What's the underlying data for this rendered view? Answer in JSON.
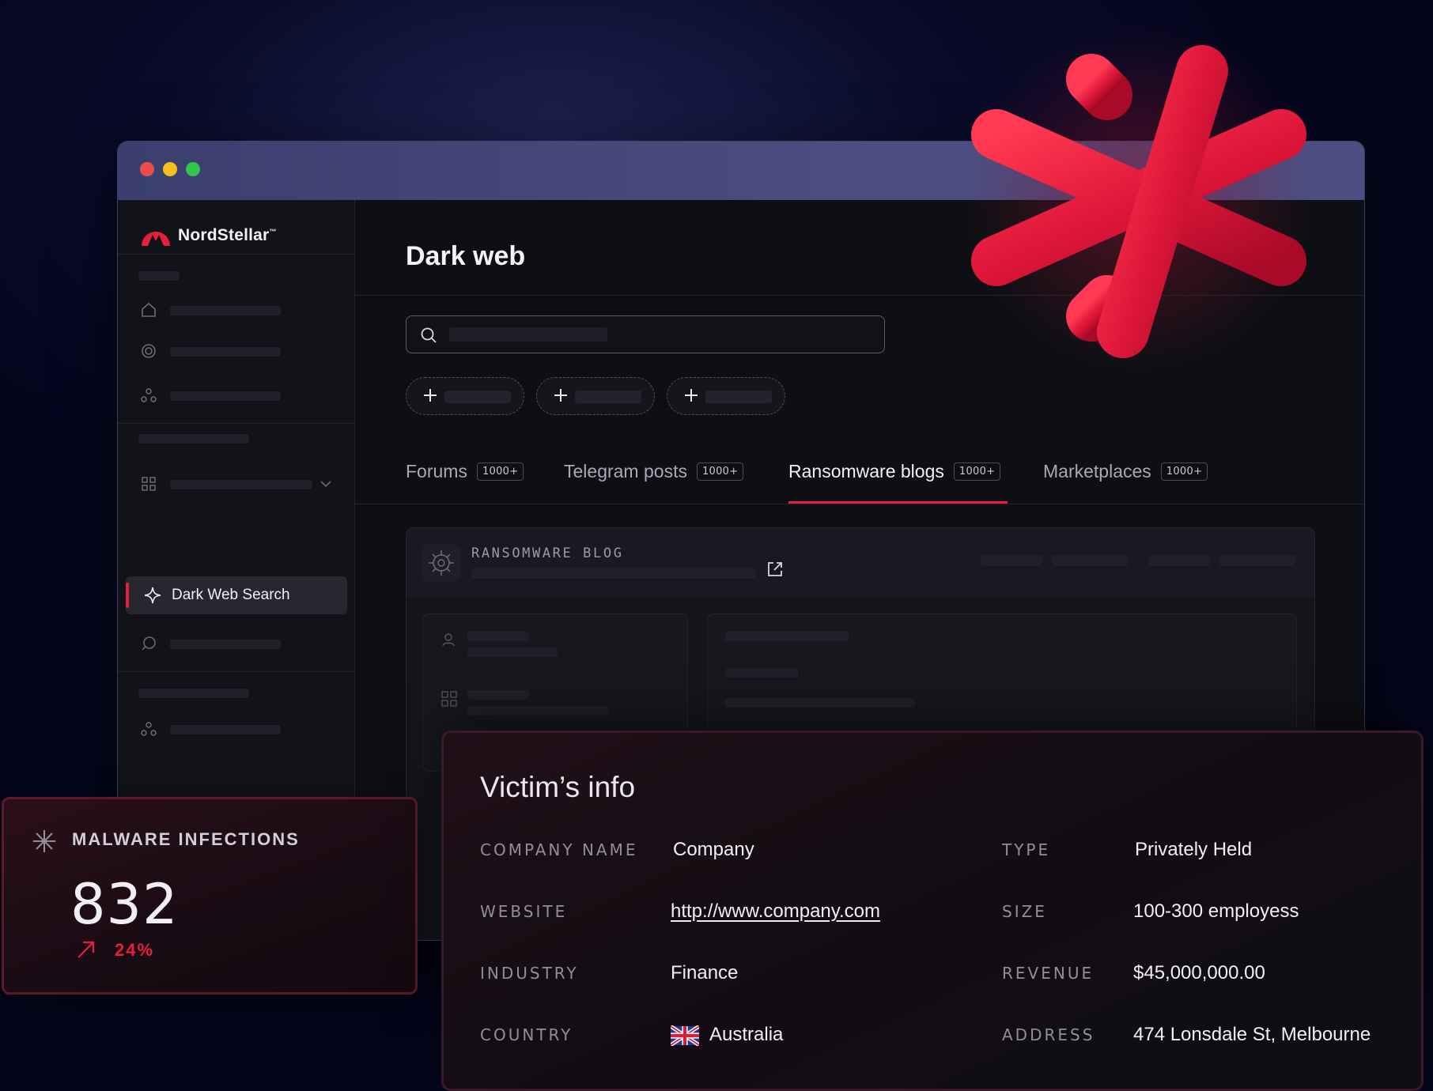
{
  "window": {
    "controls": [
      "close",
      "minimize",
      "maximize"
    ]
  },
  "sidebar": {
    "brand": "NordStellar",
    "brand_mark": "™",
    "active_item": {
      "label": "Dark Web Search",
      "icon": "sparkle-icon"
    }
  },
  "main": {
    "title": "Dark web",
    "tabs": [
      {
        "label": "Forums",
        "badge": "1000+"
      },
      {
        "label": "Telegram posts",
        "badge": "1000+"
      },
      {
        "label": "Ransomware blogs",
        "badge": "1000+",
        "active": true
      },
      {
        "label": "Marketplaces",
        "badge": "1000+"
      }
    ],
    "card": {
      "label": "RANSOMWARE BLOG"
    }
  },
  "malware": {
    "title": "MALWARE INFECTIONS",
    "value": "832",
    "change": "24%",
    "accent": "#e5203a"
  },
  "victim": {
    "title": "Victim’s info",
    "fields": {
      "company_name": {
        "label": "COMPANY NAME",
        "value": "Company"
      },
      "type": {
        "label": "TYPE",
        "value": "Privately Held"
      },
      "website": {
        "label": "WEBSITE",
        "value": "http://www.company.com"
      },
      "size": {
        "label": "SIZE",
        "value": "100-300 employess"
      },
      "industry": {
        "label": "INDUSTRY",
        "value": "Finance"
      },
      "revenue": {
        "label": "REVENUE",
        "value": "$45,000,000.00"
      },
      "country": {
        "label": "COUNTRY",
        "value": "Australia",
        "flag": "union-jack-flag-icon"
      },
      "address": {
        "label": "ADDRESS",
        "value": "474 Lonsdale St, Melbourne"
      }
    }
  },
  "colors": {
    "accent": "#e5203a",
    "background": "#05061c"
  }
}
